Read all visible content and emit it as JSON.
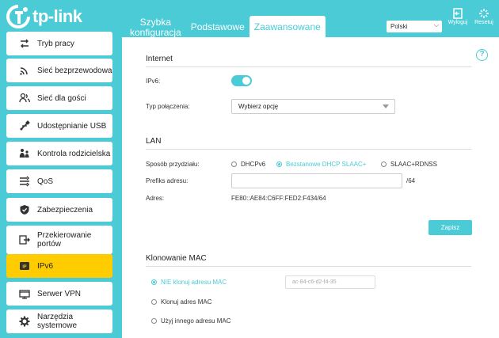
{
  "brand": {
    "name": "tp-link",
    "accent": "#4acbd6",
    "highlight": "#ffcc00"
  },
  "nav": {
    "tabs": [
      {
        "line1": "Szybka",
        "line2": "konfiguracja"
      },
      {
        "label": "Podstawowe"
      },
      {
        "label": "Zaawansowane",
        "active": true
      }
    ]
  },
  "header": {
    "language": "Polski",
    "logout_label": "Wyloguj",
    "reset_label": "Resetuj"
  },
  "sidebar": {
    "items": [
      {
        "label": "Tryb pracy",
        "icon": "swap-arrows-icon"
      },
      {
        "label": "Sieć bezprzewodowa",
        "icon": "wifi-icon"
      },
      {
        "label": "Sieć dla gości",
        "icon": "guest-users-icon"
      },
      {
        "label": "Udostępnianie USB",
        "icon": "usb-icon"
      },
      {
        "label": "Kontrola rodzicielska",
        "icon": "family-icon"
      },
      {
        "label": "QoS",
        "icon": "qos-icon"
      },
      {
        "label": "Zabezpieczenia",
        "icon": "shield-icon"
      },
      {
        "label": "Przekierowanie portów",
        "icon": "port-forward-icon"
      },
      {
        "label": "IPv6",
        "icon": "ipv6-icon",
        "active": true
      },
      {
        "label": "Serwer VPN",
        "icon": "vpn-icon"
      },
      {
        "label": "Narzędzia systemowe",
        "icon": "gear-icon"
      }
    ]
  },
  "internet": {
    "title": "Internet",
    "ipv6_label": "IPv6:",
    "ipv6_enabled": true,
    "conn_type_label": "Typ połączenia:",
    "conn_type_value": "Wybierz opcję"
  },
  "lan": {
    "title": "LAN",
    "assign_label": "Sposób przydziału:",
    "options": [
      "DHCPv6",
      "Bezstanowe DHCP SLAAC+",
      "SLAAC+RDNSS"
    ],
    "selected_option": "Bezstanowe DHCP SLAAC+",
    "prefix_label": "Prefiks adresu:",
    "prefix_value": "",
    "prefix_suffix": "/64",
    "address_label": "Adres:",
    "address_value": "FE80::AE84:C6FF:FED2:F434/64",
    "save_label": "Zapisz"
  },
  "mac_clone": {
    "title": "Klonowanie MAC",
    "options": [
      "NIE klonuj adresu MAC",
      "Klonuj adres MAC",
      "Użyj innego adresu MAC"
    ],
    "selected_option": "NIE klonuj adresu MAC",
    "mac_value": "ac-84-c6-d2-f4-35"
  }
}
